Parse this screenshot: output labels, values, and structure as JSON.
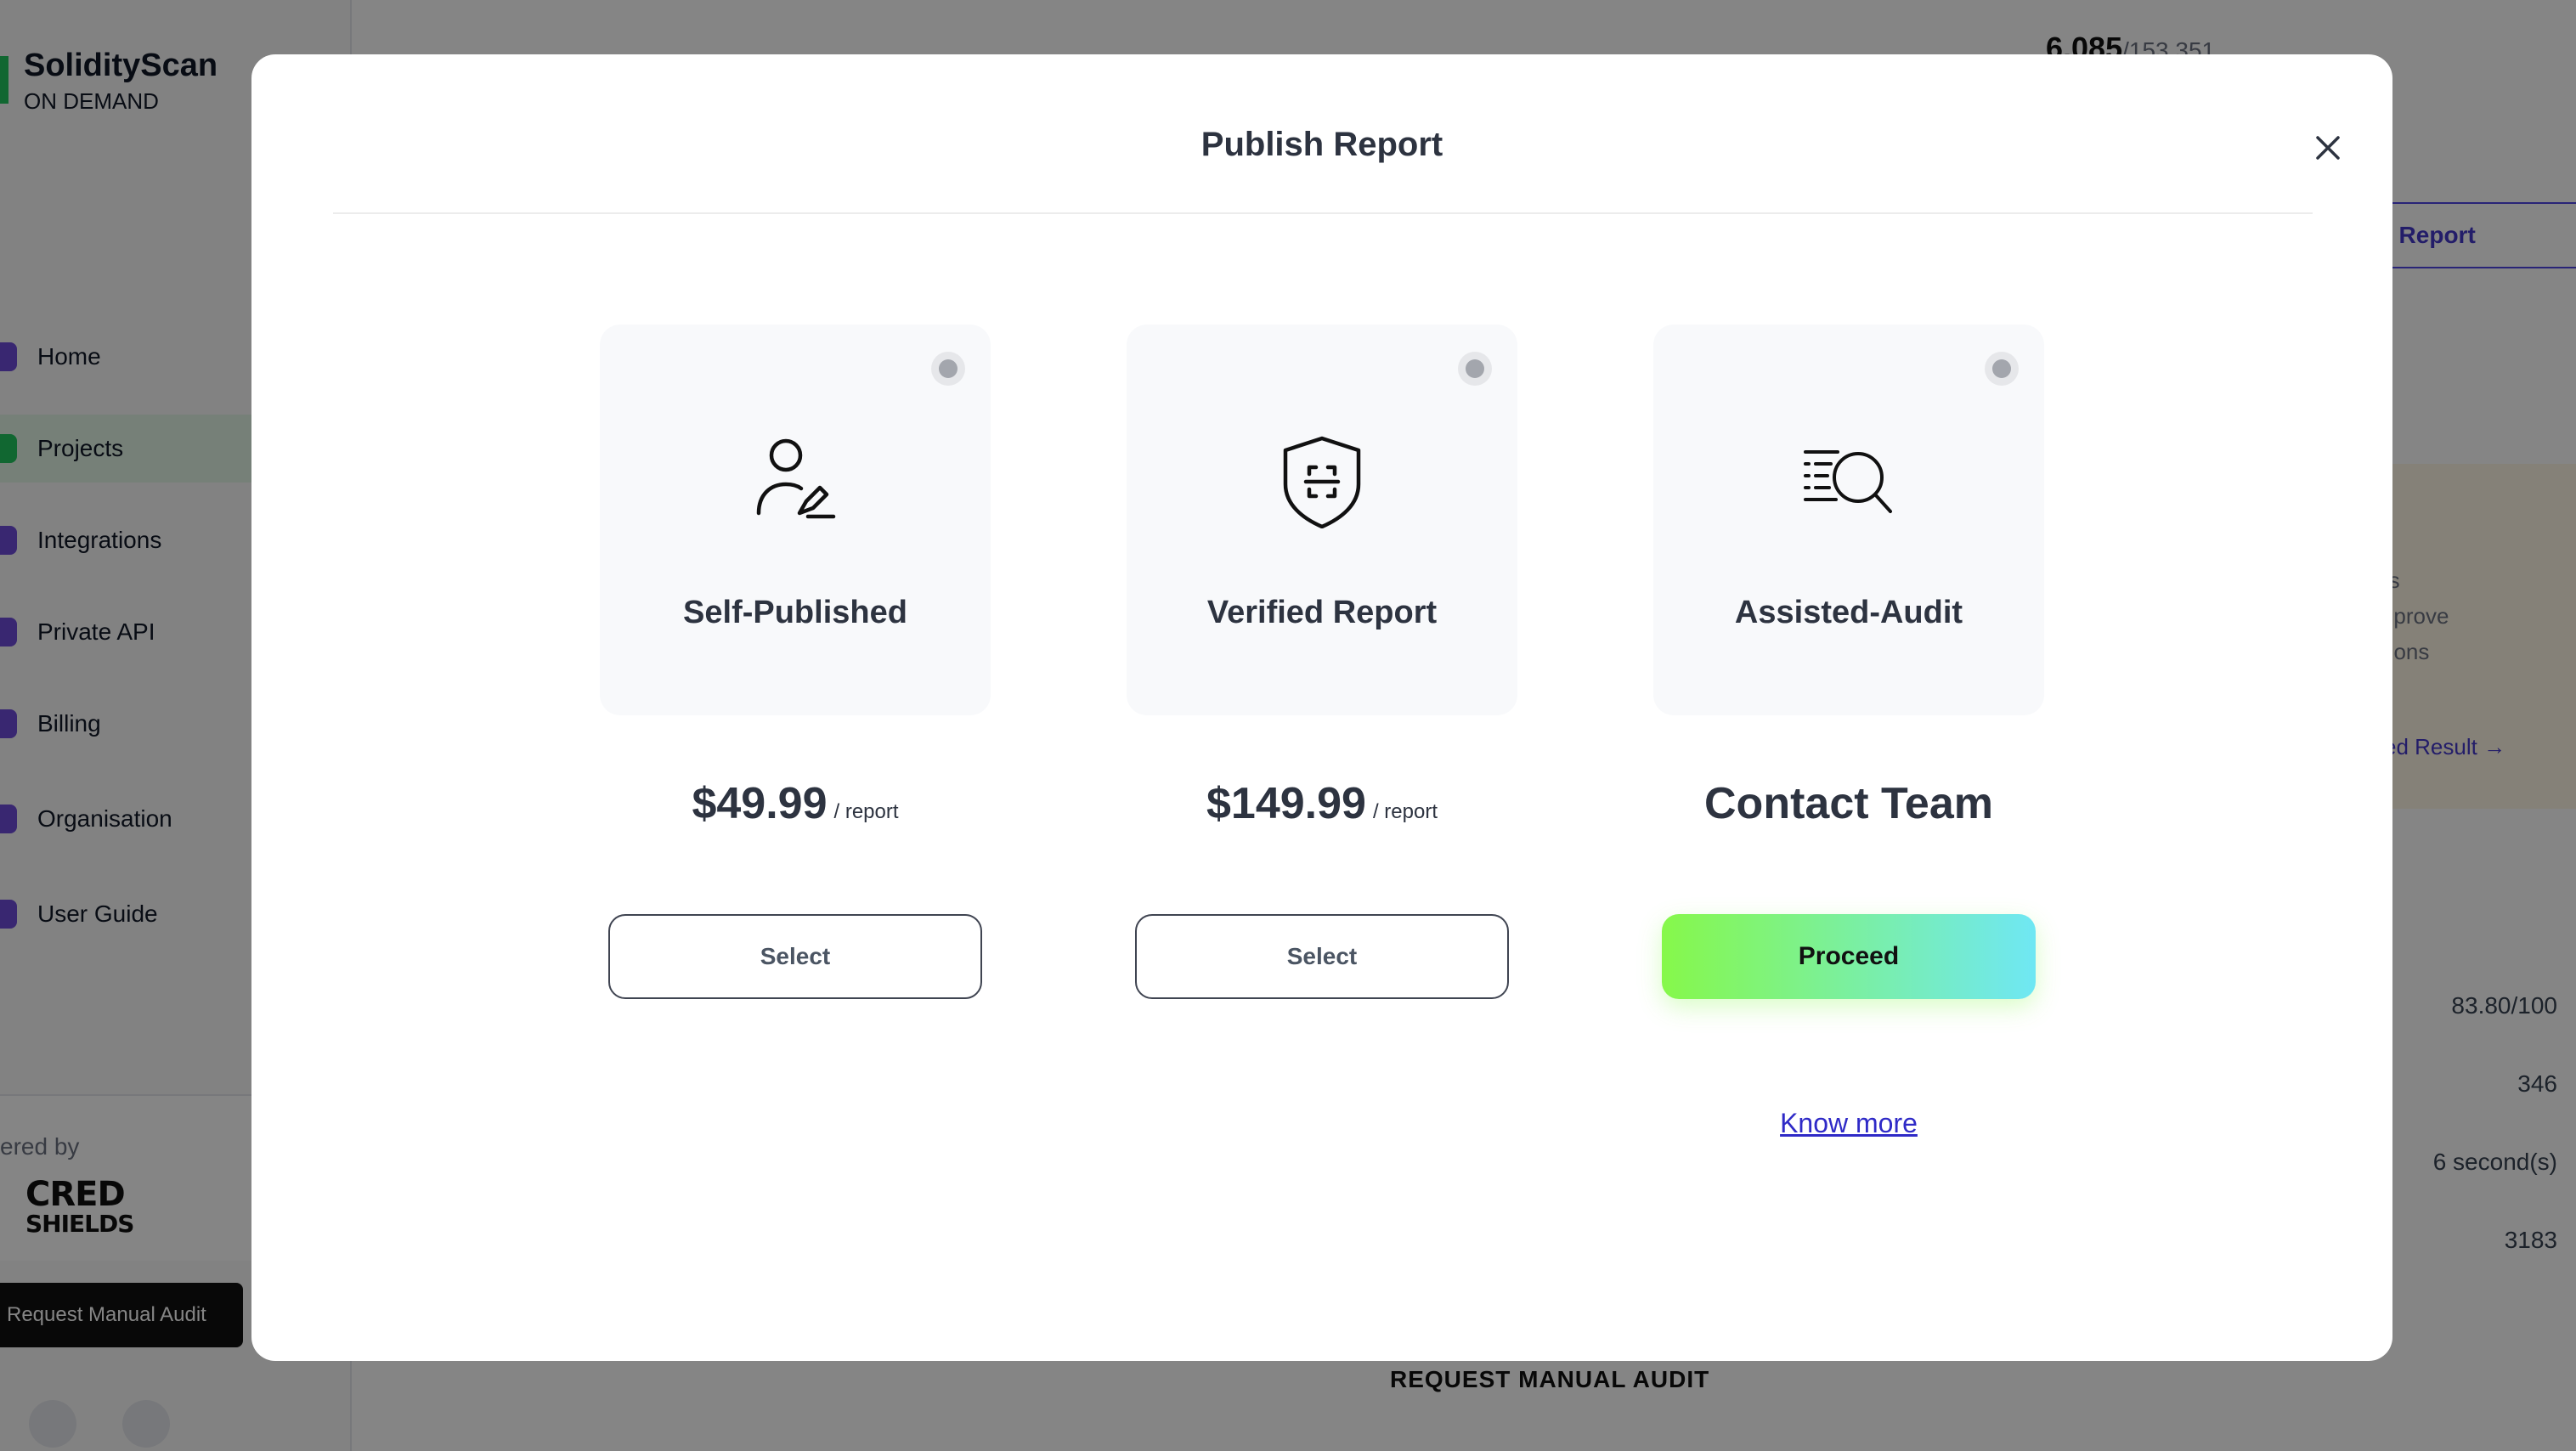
{
  "app": {
    "brand_name": "SolidityScan",
    "brand_sub": "ON DEMAND"
  },
  "sidebar": {
    "items": [
      {
        "label": "Home"
      },
      {
        "label": "Projects"
      },
      {
        "label": "Integrations"
      },
      {
        "label": "Private API"
      },
      {
        "label": "Billing"
      },
      {
        "label": "Organisation"
      },
      {
        "label": "User Guide"
      }
    ],
    "active_index": 1,
    "powered_by": "ered by",
    "powered_logo_line1": "CRED",
    "powered_logo_line2": "SHIELDS",
    "request_audit": "Request Manual Audit"
  },
  "background": {
    "scans_count": "6,085",
    "scans_total": "/153,351",
    "view_report": "w Report",
    "insight_lines": [
      "hts",
      "improve",
      "utions"
    ],
    "detailed_result": "ailed Result",
    "metrics": [
      "83.80/100",
      "346",
      "6 second(s)",
      "3183"
    ],
    "request_manual_audit": "REQUEST MANUAL AUDIT"
  },
  "modal": {
    "title": "Publish Report",
    "options": [
      {
        "label": "Self-Published",
        "icon": "user-edit-icon",
        "price": "$49.99",
        "unit": "/ report",
        "action": "Select"
      },
      {
        "label": "Verified Report",
        "icon": "shield-scan-icon",
        "price": "$149.99",
        "unit": "/ report",
        "action": "Select"
      },
      {
        "label": "Assisted-Audit",
        "icon": "list-search-icon",
        "price_text": "Contact Team",
        "action": "Proceed"
      }
    ],
    "know_more": "Know more"
  },
  "colors": {
    "proceed_gradient_start": "#86f84a",
    "proceed_gradient_end": "#6fe7f4",
    "link": "#2f2ac7",
    "overlay": "rgba(0,0,0,0.48)"
  }
}
